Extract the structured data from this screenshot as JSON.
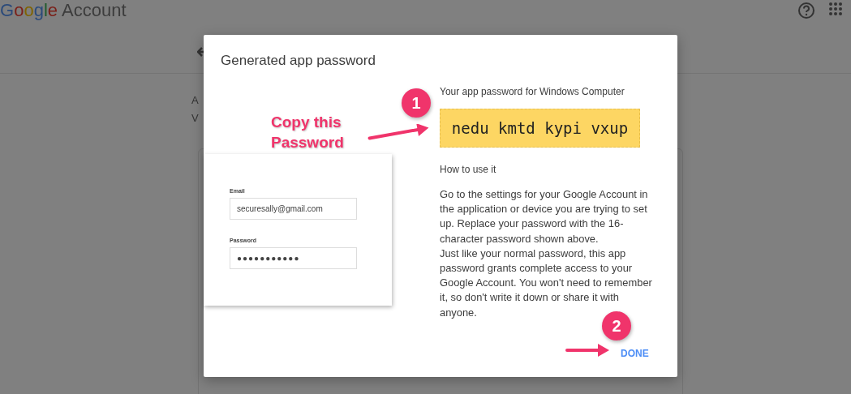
{
  "header": {
    "logo": "Google",
    "product": "Account"
  },
  "page": {
    "lines": [
      "A",
      "V"
    ]
  },
  "dialog": {
    "title": "Generated app password",
    "annotation": "Copy this Password",
    "steps": [
      "1",
      "2"
    ],
    "password_label": "Your app password for Windows Computer",
    "password": "nedu kmtd kypi vxup",
    "howto_title": "How to use it",
    "howto_paragraphs": [
      "Go to the settings for your Google Account in the application or device you are trying to set up. Replace your password with the 16-character password shown above.",
      "Just like your normal password, this app password grants complete access to your Google Account. You won't need to remember it, so don't write it down or share it with anyone."
    ],
    "done": "DONE",
    "login_preview": {
      "email_label": "Email",
      "email": "securesally@gmail.com",
      "password_label": "Password",
      "password_mask": "●●●●●●●●●●●"
    }
  }
}
